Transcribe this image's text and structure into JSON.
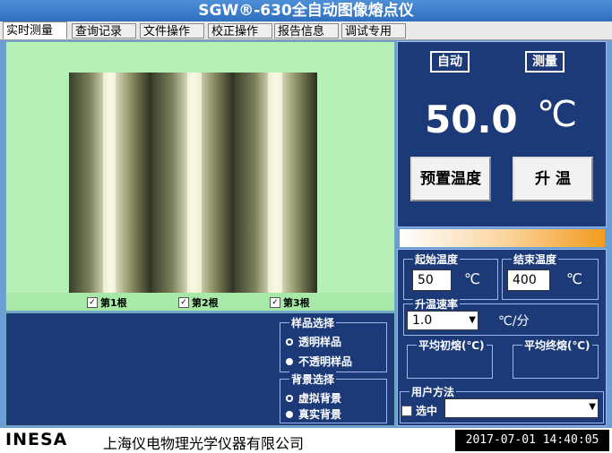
{
  "title": "SGW®-630全自动图像熔点仪",
  "tabs": [
    "实时测量",
    "查询记录",
    "文件操作",
    "校正操作",
    "报告信息",
    "调试专用"
  ],
  "camera": {
    "checks": [
      "第1根",
      "第2根",
      "第3根"
    ]
  },
  "sample": {
    "legend": "样品选择",
    "options": [
      "透明样品",
      "不透明样品"
    ]
  },
  "background": {
    "legend": "背景选择",
    "options": [
      "虚拟背景",
      "真实背景"
    ]
  },
  "status": {
    "mode": "自动",
    "state": "测量",
    "temperature": "50.0",
    "unit": "℃"
  },
  "buttons": {
    "preset": "预置温度",
    "heat": "升 温"
  },
  "params": {
    "start_label": "起始温度",
    "start_value": "50",
    "start_unit": "℃",
    "end_label": "结束温度",
    "end_value": "400",
    "end_unit": "℃",
    "rate_label": "升温速率",
    "rate_value": "1.0",
    "rate_unit": "℃/分",
    "initial_label": "平均初熔(℃)",
    "final_label": "平均终熔(℃)"
  },
  "user": {
    "legend": "用户方法",
    "select_label": "选中"
  },
  "footer": {
    "logo": "INESA",
    "company": "上海仪电物理光学仪器有限公司",
    "datetime": "2017-07-01  14:40:05"
  }
}
